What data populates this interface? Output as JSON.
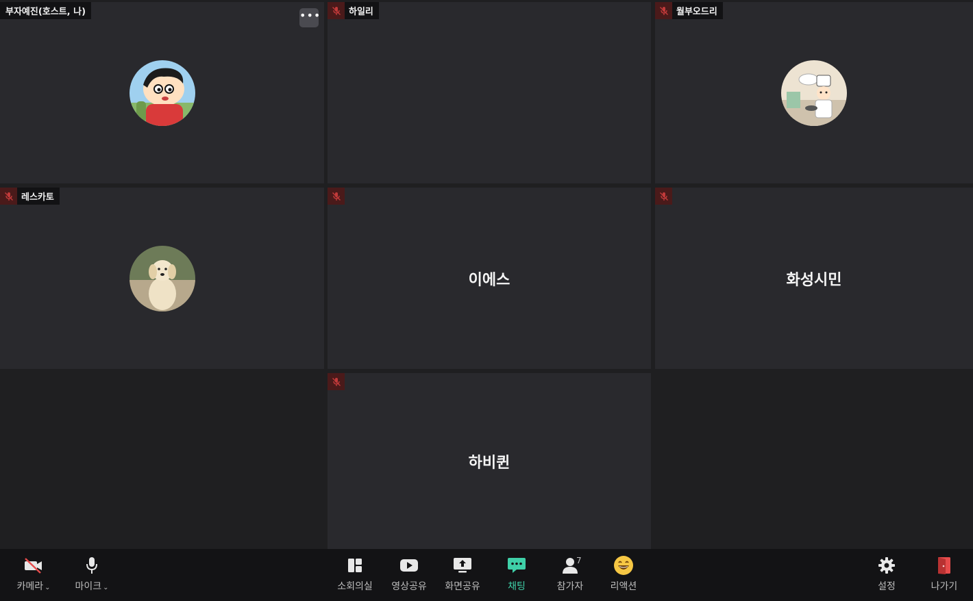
{
  "tiles": {
    "host": {
      "name": "부자예진(호스트, 나)",
      "more": "•••"
    },
    "haili": {
      "name": "하일리"
    },
    "wolbu": {
      "name": "월부오드리"
    },
    "lescato": {
      "name": "레스카토"
    },
    "ies": {
      "center_name": "이에스"
    },
    "hwaseong": {
      "center_name": "화성시민"
    },
    "habiquin": {
      "center_name": "하비퀸"
    }
  },
  "toolbar": {
    "camera": {
      "label": "카메라"
    },
    "mic": {
      "label": "마이크"
    },
    "breakout": {
      "label": "소회의실"
    },
    "video_share": {
      "label": "영상공유"
    },
    "screen_share": {
      "label": "화면공유"
    },
    "chat": {
      "label": "채팅"
    },
    "participants": {
      "label": "참가자",
      "count": "7"
    },
    "reaction": {
      "label": "리액션"
    },
    "settings": {
      "label": "설정"
    },
    "leave": {
      "label": "나가기"
    }
  },
  "colors": {
    "accent": "#3fd0a8",
    "leave": "#e74c4c",
    "muted_bg": "#4a1a1a",
    "tile_bg": "#29292d"
  }
}
